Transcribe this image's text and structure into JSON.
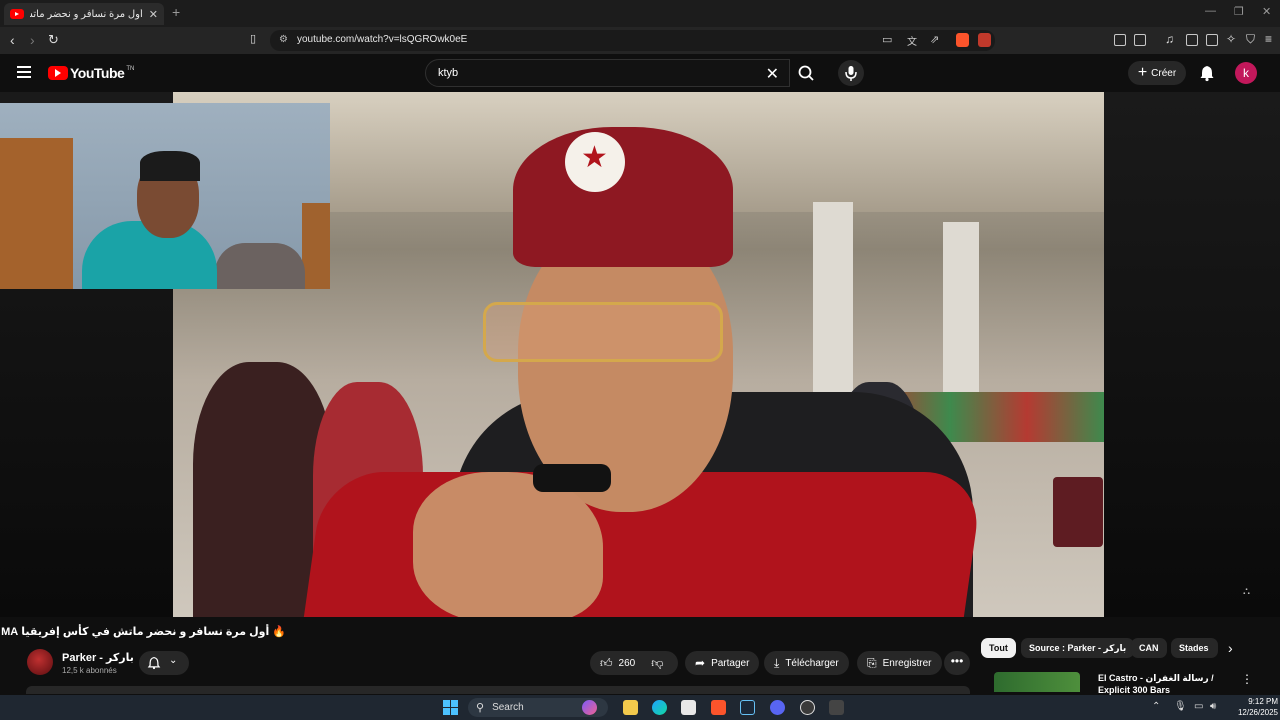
{
  "browser": {
    "tab_title": "أول مرة نسافر و نحضر ماتش في كأس إفريقيا",
    "tab_close": "✕",
    "new_tab": "+",
    "url": "youtube.com/watch?v=lsQGROwk0eE",
    "window_controls": [
      "—",
      "❐",
      "✕"
    ]
  },
  "youtube": {
    "logo_text": "YouTube",
    "logo_country": "TN",
    "search_value": "ktyb",
    "create_label": "Créer",
    "avatar_letter": "k"
  },
  "video": {
    "title": "🔥 أول مرة نسافر و نحضر ماتش في كأس إفريقيا TN MA",
    "channel_name": "Parker - باركر",
    "subscribers": "12,5 k abonnés",
    "likes": "260",
    "share_label": "Partager",
    "download_label": "Télécharger",
    "save_label": "Enregistrer",
    "more_label": "•••"
  },
  "chips": [
    "Tout",
    "Source : Parker - باركر",
    "CAN",
    "Stades"
  ],
  "recommendation": {
    "title": "El Castro - رسالة الغفران / Explicit 300 Bars"
  },
  "taskbar": {
    "search_label": "Search",
    "time": "9:12 PM",
    "date": "12/26/2025"
  }
}
